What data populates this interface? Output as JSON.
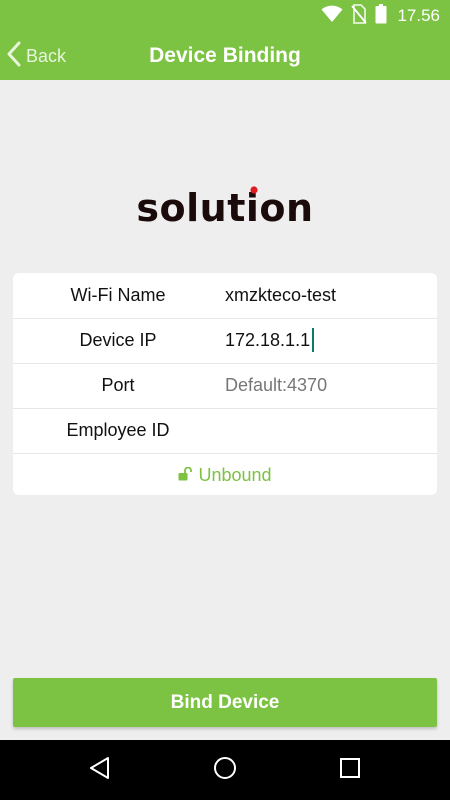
{
  "status_bar": {
    "time": "17.56",
    "icons": [
      "wifi-icon",
      "no-sim-icon",
      "battery-icon"
    ]
  },
  "app_bar": {
    "back_label": "Back",
    "title": "Device Binding"
  },
  "logo": {
    "text": "solution",
    "colors": {
      "main": "#1a0a0a",
      "accent": "#e11b22"
    }
  },
  "form": {
    "rows": [
      {
        "label": "Wi-Fi Name",
        "value": "xmzkteco-test"
      },
      {
        "label": "Device IP",
        "value": "172.18.1.1"
      },
      {
        "label": "Port",
        "value": "",
        "placeholder": "Default:4370"
      },
      {
        "label": "Employee ID",
        "value": ""
      }
    ],
    "status": {
      "icon": "unlock-icon",
      "label": "Unbound"
    }
  },
  "bind_button": {
    "label": "Bind Device"
  },
  "nav_bar": {
    "icons": [
      "back-triangle-icon",
      "home-circle-icon",
      "recents-square-icon"
    ]
  },
  "colors": {
    "accent_green": "#7cc243",
    "background": "#eeeeee",
    "nav_bar": "#000000",
    "cursor": "#0b7a6e"
  }
}
